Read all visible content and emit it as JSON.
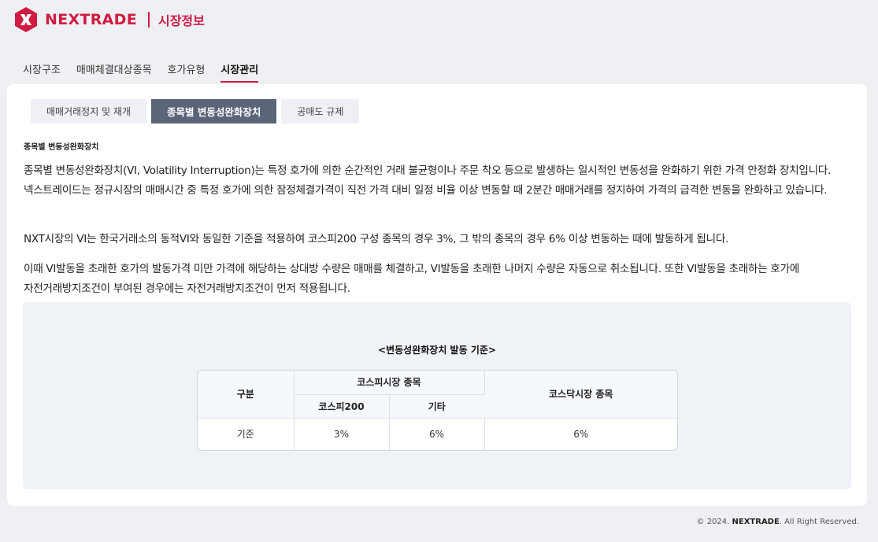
{
  "header": {
    "brand": "NEXTRADE",
    "section": "시장정보",
    "brand_color": "#d11b41"
  },
  "nav": {
    "items": [
      {
        "label": "시장구조"
      },
      {
        "label": "매매체결대상종목"
      },
      {
        "label": "호가유형"
      },
      {
        "label": "시장관리",
        "active": true
      }
    ]
  },
  "subtabs": [
    {
      "label": "매매거래정지 및 재개"
    },
    {
      "label": "종목별 변동성완화장치",
      "active": true
    },
    {
      "label": "공매도 규제"
    }
  ],
  "content": {
    "title": "종목별 변동성완화장치",
    "paragraphs": [
      "종목별 변동성완화장치(VI, Volatility Interruption)는 특정 호가에 의한 순간적인 거래 불균형이나 주문 착오 등으로 발생하는 일시적인 변동성을 완화하기 위한 가격 안정화 장치입니다. 넥스트레이드는 정규시장의 매매시간 중 특정 호가에 의한 잠정체결가격이 직전 가격 대비 일정 비율 이상 변동할 때 2분간 매매거래를 정지하여 가격의 급격한 변동을 완화하고 있습니다.",
      "NXT시장의 VI는 한국거래소의 동적VI와 동일한 기준을 적용하여 코스피200 구성 종목의 경우 3%, 그 밖의 종목의 경우 6% 이상 변동하는 때에 발동하게 됩니다.",
      "이때 VI발동을 초래한 호가의 발동가격 미만 가격에 해당하는 상대방 수량은 매매를 체결하고, VI발동을 초래한 나머지 수량은 자동으로 취소됩니다. 또한 VI발동을 초래하는 호가에 자전거래방지조건이 부여된 경우에는 자전거래방지조건이 먼저 적용됩니다."
    ]
  },
  "table": {
    "title": "<변동성완화장치 발동 기준>",
    "headers": {
      "category": "구분",
      "kospi": "코스피시장 종목",
      "kospi200": "코스피200",
      "other": "기타",
      "kosdaq": "코스닥시장 종목"
    },
    "rows": [
      {
        "label": "기준",
        "kospi200": "3%",
        "other": "6%",
        "kosdaq": "6%"
      }
    ]
  },
  "footer": {
    "prefix": "© 2024.",
    "brand": "NEXTRADE",
    "suffix": ". All Right Reserved."
  }
}
